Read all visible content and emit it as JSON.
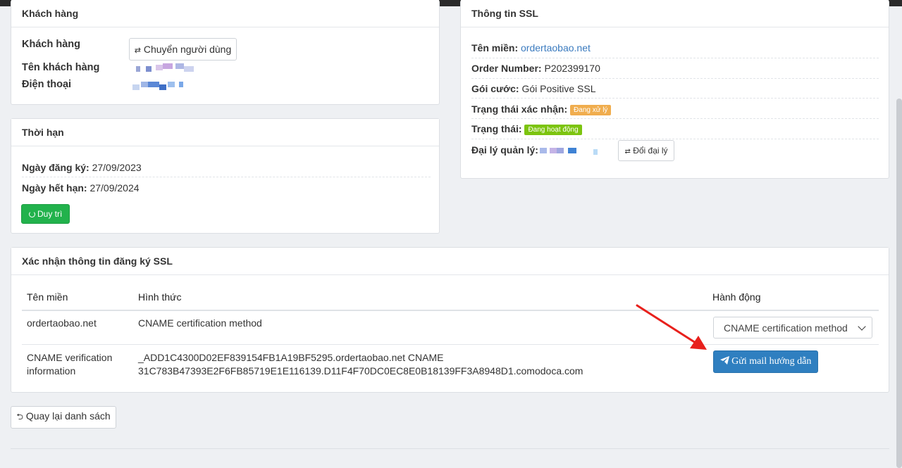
{
  "customer": {
    "title": "Khách hàng",
    "customer_label": "Khách hàng",
    "switch_button": "Chuyển người dùng",
    "name_label": "Tên khách hàng",
    "phone_label": "Điện thoại"
  },
  "term": {
    "title": "Thời hạn",
    "reg_label": "Ngày đăng ký:",
    "reg_value": "27/09/2023",
    "exp_label": "Ngày hết hạn:",
    "exp_value": "27/09/2024",
    "renew_button": "Duy trì"
  },
  "ssl": {
    "title": "Thông tin SSL",
    "domain_label": "Tên miền:",
    "domain_value": "ordertaobao.net",
    "order_label": "Order Number:",
    "order_value": "P202399170",
    "plan_label": "Gói cước:",
    "plan_value": "Gói Positive SSL",
    "verify_status_label": "Trạng thái xác nhận:",
    "verify_status_badge": "Đang xử lý",
    "status_label": "Trạng thái:",
    "status_badge": "Đang hoạt động",
    "agent_label": "Đại lý quản lý:",
    "change_agent_button": "Đổi đại lý"
  },
  "verification": {
    "title": "Xác nhận thông tin đăng ký SSL",
    "headers": [
      "Tên miền",
      "Hình thức",
      "Hành động"
    ],
    "row1": {
      "domain": "ordertaobao.net",
      "method": "CNAME certification method",
      "select_value": "CNAME certification method"
    },
    "row2": {
      "label_line1": "CNAME verification",
      "label_line2": "information",
      "info_line1": "_ADD1C4300D02EF839154FB1A19BF5295.ordertaobao.net CNAME",
      "info_line2": "31C783B47393E2F6FB85719E1E116139.D11F4F70DC0EC8E0B18139FF3A8948D1.comodoca.com",
      "send_mail_button": "Gửi mail hướng dẫn"
    }
  },
  "footer": {
    "back_button": "Quay lại danh sách"
  },
  "colors": {
    "success": "#22b24c",
    "primary": "#2f7fc0",
    "warning_badge": "#f0ad4e",
    "active_badge": "#7cc40f",
    "arrow": "#e8201c"
  }
}
